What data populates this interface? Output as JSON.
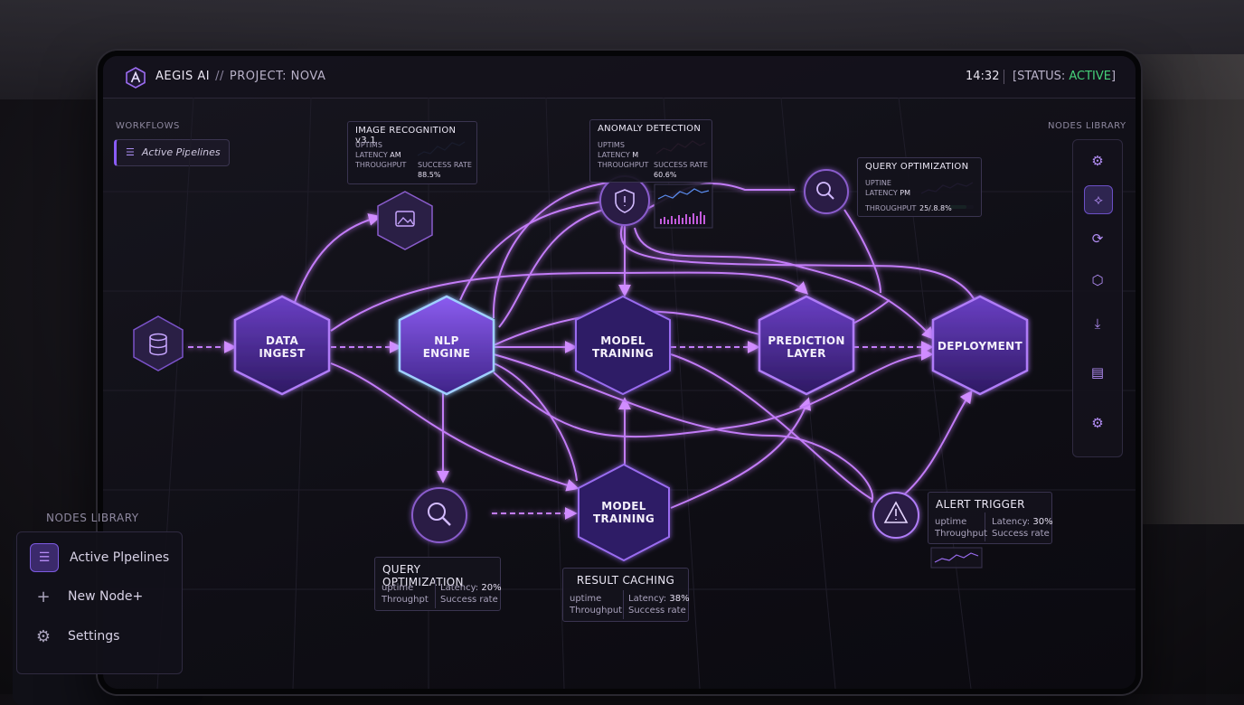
{
  "header": {
    "brand": "AEGIS AI",
    "separator": "//",
    "project": "PROJECT: NOVA",
    "time": "14:32",
    "status_prefix": "[STATUS: ",
    "status_value": "ACTIVE",
    "status_suffix": "]"
  },
  "workflows": {
    "label": "WORKFLOWS",
    "item": "Active Pipelines"
  },
  "nodes_library_right": {
    "label": "NODES LIBRARY"
  },
  "nodes_library_left": {
    "label": "NODES LIBRARY",
    "items": [
      {
        "label": "Active Plpelines",
        "icon": "list-icon"
      },
      {
        "label": "New Node+",
        "icon": "plus-icon"
      },
      {
        "label": "Settings",
        "icon": "gear-icon"
      }
    ]
  },
  "nodes": {
    "data_ingest": [
      "DATA",
      "INGEST"
    ],
    "nlp_engine": [
      "NLP",
      "ENGINE"
    ],
    "model_training_top": [
      "MODEL",
      "TRAINING"
    ],
    "prediction_layer": [
      "PREDICTION",
      "LAYER"
    ],
    "deployment": [
      "DEPLOYMENT"
    ],
    "model_training_bottom": [
      "MODEL",
      "TRAINING"
    ]
  },
  "panels": {
    "image_recognition": {
      "title": "IMAGE RECOGNITION v3.1",
      "l1": "UPTIMS",
      "l2": "LATENCY",
      "l2v": "AM",
      "l3": "THROUGHPUT",
      "r1": "SUCCESS RATE",
      "r2": "88.5%"
    },
    "anomaly_detection": {
      "title": "ANOMALY DETECTION",
      "l1": "UPTIMS",
      "l2": "LATENCY",
      "l2v": "M",
      "l3": "THROUGHPUT",
      "r1": "SUCCESS RATE",
      "r2": "60.6%"
    },
    "query_opt_top": {
      "title": "QUERY OPTIMIZATION",
      "l1": "UPTINE",
      "l2": "LATENCY",
      "l2v": "PM",
      "l3": "THROUGHPUT",
      "r3": "25/.8.8%"
    },
    "query_opt_bottom": {
      "title": "QUERY OPTIMIZATION",
      "l1": "uptime",
      "l2": "Throughpt",
      "r1a": "Latency:",
      "r1b": "20%",
      "r2": "Success rate"
    },
    "result_caching": {
      "title": "RESULT CACHING",
      "l1": "uptime",
      "l2": "Throughput",
      "r1a": "Latency:",
      "r1b": "38%",
      "r2": "Success rate"
    },
    "alert_trigger": {
      "title": "ALERT TRIGGER",
      "l1": "uptime",
      "l2": "Throughput",
      "r1a": "Latency:",
      "r1b": "30%",
      "r2": "Success rate"
    }
  },
  "right_rail_icons": [
    "gear-icon",
    "network-icon",
    "sync-icon",
    "box-icon",
    "download-icon",
    "clipboard-icon",
    "settings-icon"
  ],
  "colors": {
    "accent": "#a46cf5",
    "link": "#c27bf7",
    "status": "#46d27a",
    "bg": "#0f0e15"
  }
}
